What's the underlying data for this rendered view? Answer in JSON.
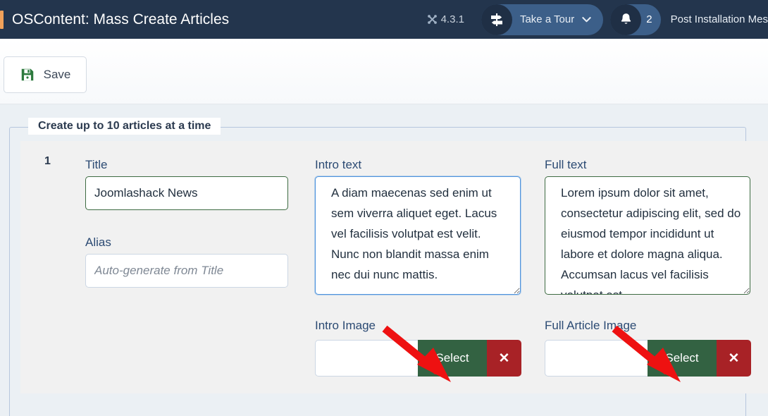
{
  "topbar": {
    "title": "OSContent: Mass Create Articles",
    "version": "4.3.1",
    "version_icon": "joomla-logo-icon",
    "tour_label": "Take a Tour",
    "tour_icon": "signpost-icon",
    "tour_chevron": "chevron-down-icon",
    "notifications_icon": "bell-icon",
    "notifications_count": "2",
    "post_install_label": "Post Installation Mes",
    "bg_color": "#23354d",
    "pill_color": "#3c5f89"
  },
  "toolbar": {
    "save_label": "Save",
    "save_icon": "floppy-disk-icon"
  },
  "fieldset": {
    "legend": "Create up to 10 articles at a time"
  },
  "row": {
    "number": "1",
    "title": {
      "label": "Title",
      "value": "Joomlashack News",
      "placeholder": ""
    },
    "alias": {
      "label": "Alias",
      "value": "",
      "placeholder": "Auto-generate from Title"
    },
    "intro_text": {
      "label": "Intro text",
      "value": "A diam maecenas sed enim ut sem viverra aliquet eget. Lacus vel facilisis volutpat est velit. Nunc non blandit massa enim nec dui nunc mattis."
    },
    "full_text": {
      "label": "Full text",
      "value": "Lorem ipsum dolor sit amet, consectetur adipiscing elit, sed do eiusmod tempor incididunt ut labore et dolore magna aliqua. Accumsan lacus vel facilisis volutpat est."
    },
    "intro_image": {
      "label": "Intro Image",
      "value": "",
      "placeholder": "",
      "select_label": "Select",
      "clear_label": "✕"
    },
    "full_image": {
      "label": "Full Article Image",
      "value": "",
      "placeholder": "",
      "select_label": "Select",
      "clear_label": "✕"
    }
  },
  "annotations": {
    "arrow_color": "#ee1111",
    "arrow_1_target": "intro-image-select-button",
    "arrow_2_target": "full-image-select-button"
  },
  "colors": {
    "green_button": "#336242",
    "red_button": "#a82226",
    "valid_border": "#3d6b42",
    "focus_border": "#4f94dd",
    "page_bg": "#ebf0f4"
  }
}
